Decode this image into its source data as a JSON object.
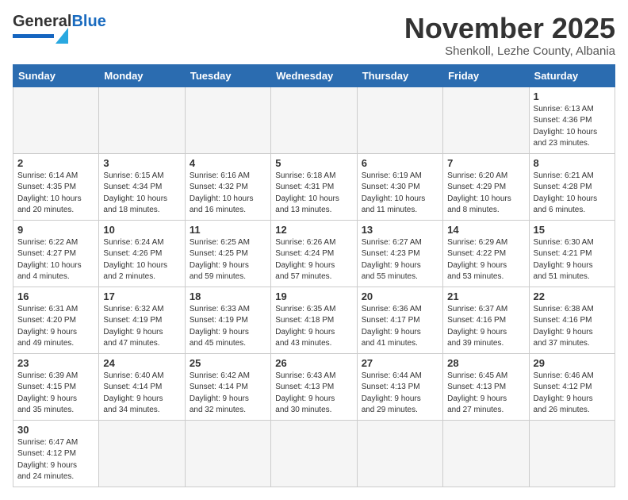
{
  "header": {
    "month_title": "November 2025",
    "location": "Shenkoll, Lezhe County, Albania",
    "logo_general": "General",
    "logo_blue": "Blue"
  },
  "weekdays": [
    "Sunday",
    "Monday",
    "Tuesday",
    "Wednesday",
    "Thursday",
    "Friday",
    "Saturday"
  ],
  "weeks": [
    [
      {
        "day": "",
        "info": ""
      },
      {
        "day": "",
        "info": ""
      },
      {
        "day": "",
        "info": ""
      },
      {
        "day": "",
        "info": ""
      },
      {
        "day": "",
        "info": ""
      },
      {
        "day": "",
        "info": ""
      },
      {
        "day": "1",
        "info": "Sunrise: 6:13 AM\nSunset: 4:36 PM\nDaylight: 10 hours\nand 23 minutes."
      }
    ],
    [
      {
        "day": "2",
        "info": "Sunrise: 6:14 AM\nSunset: 4:35 PM\nDaylight: 10 hours\nand 20 minutes."
      },
      {
        "day": "3",
        "info": "Sunrise: 6:15 AM\nSunset: 4:34 PM\nDaylight: 10 hours\nand 18 minutes."
      },
      {
        "day": "4",
        "info": "Sunrise: 6:16 AM\nSunset: 4:32 PM\nDaylight: 10 hours\nand 16 minutes."
      },
      {
        "day": "5",
        "info": "Sunrise: 6:18 AM\nSunset: 4:31 PM\nDaylight: 10 hours\nand 13 minutes."
      },
      {
        "day": "6",
        "info": "Sunrise: 6:19 AM\nSunset: 4:30 PM\nDaylight: 10 hours\nand 11 minutes."
      },
      {
        "day": "7",
        "info": "Sunrise: 6:20 AM\nSunset: 4:29 PM\nDaylight: 10 hours\nand 8 minutes."
      },
      {
        "day": "8",
        "info": "Sunrise: 6:21 AM\nSunset: 4:28 PM\nDaylight: 10 hours\nand 6 minutes."
      }
    ],
    [
      {
        "day": "9",
        "info": "Sunrise: 6:22 AM\nSunset: 4:27 PM\nDaylight: 10 hours\nand 4 minutes."
      },
      {
        "day": "10",
        "info": "Sunrise: 6:24 AM\nSunset: 4:26 PM\nDaylight: 10 hours\nand 2 minutes."
      },
      {
        "day": "11",
        "info": "Sunrise: 6:25 AM\nSunset: 4:25 PM\nDaylight: 9 hours\nand 59 minutes."
      },
      {
        "day": "12",
        "info": "Sunrise: 6:26 AM\nSunset: 4:24 PM\nDaylight: 9 hours\nand 57 minutes."
      },
      {
        "day": "13",
        "info": "Sunrise: 6:27 AM\nSunset: 4:23 PM\nDaylight: 9 hours\nand 55 minutes."
      },
      {
        "day": "14",
        "info": "Sunrise: 6:29 AM\nSunset: 4:22 PM\nDaylight: 9 hours\nand 53 minutes."
      },
      {
        "day": "15",
        "info": "Sunrise: 6:30 AM\nSunset: 4:21 PM\nDaylight: 9 hours\nand 51 minutes."
      }
    ],
    [
      {
        "day": "16",
        "info": "Sunrise: 6:31 AM\nSunset: 4:20 PM\nDaylight: 9 hours\nand 49 minutes."
      },
      {
        "day": "17",
        "info": "Sunrise: 6:32 AM\nSunset: 4:19 PM\nDaylight: 9 hours\nand 47 minutes."
      },
      {
        "day": "18",
        "info": "Sunrise: 6:33 AM\nSunset: 4:19 PM\nDaylight: 9 hours\nand 45 minutes."
      },
      {
        "day": "19",
        "info": "Sunrise: 6:35 AM\nSunset: 4:18 PM\nDaylight: 9 hours\nand 43 minutes."
      },
      {
        "day": "20",
        "info": "Sunrise: 6:36 AM\nSunset: 4:17 PM\nDaylight: 9 hours\nand 41 minutes."
      },
      {
        "day": "21",
        "info": "Sunrise: 6:37 AM\nSunset: 4:16 PM\nDaylight: 9 hours\nand 39 minutes."
      },
      {
        "day": "22",
        "info": "Sunrise: 6:38 AM\nSunset: 4:16 PM\nDaylight: 9 hours\nand 37 minutes."
      }
    ],
    [
      {
        "day": "23",
        "info": "Sunrise: 6:39 AM\nSunset: 4:15 PM\nDaylight: 9 hours\nand 35 minutes."
      },
      {
        "day": "24",
        "info": "Sunrise: 6:40 AM\nSunset: 4:14 PM\nDaylight: 9 hours\nand 34 minutes."
      },
      {
        "day": "25",
        "info": "Sunrise: 6:42 AM\nSunset: 4:14 PM\nDaylight: 9 hours\nand 32 minutes."
      },
      {
        "day": "26",
        "info": "Sunrise: 6:43 AM\nSunset: 4:13 PM\nDaylight: 9 hours\nand 30 minutes."
      },
      {
        "day": "27",
        "info": "Sunrise: 6:44 AM\nSunset: 4:13 PM\nDaylight: 9 hours\nand 29 minutes."
      },
      {
        "day": "28",
        "info": "Sunrise: 6:45 AM\nSunset: 4:13 PM\nDaylight: 9 hours\nand 27 minutes."
      },
      {
        "day": "29",
        "info": "Sunrise: 6:46 AM\nSunset: 4:12 PM\nDaylight: 9 hours\nand 26 minutes."
      }
    ],
    [
      {
        "day": "30",
        "info": "Sunrise: 6:47 AM\nSunset: 4:12 PM\nDaylight: 9 hours\nand 24 minutes."
      },
      {
        "day": "",
        "info": ""
      },
      {
        "day": "",
        "info": ""
      },
      {
        "day": "",
        "info": ""
      },
      {
        "day": "",
        "info": ""
      },
      {
        "day": "",
        "info": ""
      },
      {
        "day": "",
        "info": ""
      }
    ]
  ]
}
